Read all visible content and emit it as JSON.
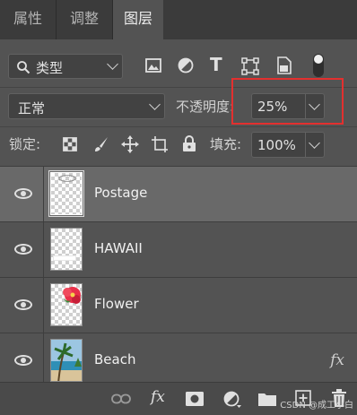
{
  "tabs": [
    {
      "label": "属性",
      "active": false
    },
    {
      "label": "调整",
      "active": false
    },
    {
      "label": "图层",
      "active": true
    }
  ],
  "filter": {
    "kind_label": "类型",
    "icons": [
      "image-filter-icon",
      "adjustment-filter-icon",
      "type-filter-icon",
      "shape-filter-icon",
      "smart-object-filter-icon",
      "filter-toggle-icon"
    ]
  },
  "blend": {
    "mode": "正常",
    "opacity_label": "不透明度:",
    "opacity_value": "25%"
  },
  "lock": {
    "label": "锁定:",
    "icons": [
      "lock-transparent-pixels-icon",
      "lock-image-pixels-icon",
      "lock-position-icon",
      "lock-artboard-icon",
      "lock-all-icon"
    ],
    "fill_label": "填充:",
    "fill_value": "100%"
  },
  "layers": [
    {
      "name": "Postage",
      "selected": true,
      "fx": false
    },
    {
      "name": "HAWAII",
      "selected": false,
      "fx": false
    },
    {
      "name": "Flower",
      "selected": false,
      "fx": false
    },
    {
      "name": "Beach",
      "selected": false,
      "fx": true
    }
  ],
  "fx_symbol": "fx",
  "bottom_icons": [
    "link-layers-icon",
    "add-layer-style-icon",
    "add-mask-icon",
    "new-adjustment-layer-icon",
    "new-group-icon",
    "new-layer-icon",
    "delete-layer-icon"
  ],
  "watermark": "CSDN @成工小白",
  "colors": {
    "highlight": "#e3302f",
    "panel": "#535353",
    "selected_row": "#696969"
  }
}
